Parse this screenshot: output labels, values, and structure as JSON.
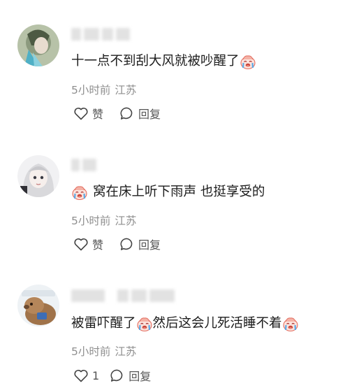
{
  "comments": [
    {
      "text_a": "十一点不到刮大风就被吵醒了",
      "text_b": "",
      "time": "5小时前",
      "location": "江苏",
      "like_label": "赞",
      "reply_label": "回复",
      "emoji": "crying-face-emoji"
    },
    {
      "text_a": "窝在床上听下雨声 也挺享受的",
      "text_b": "",
      "time": "5小时前",
      "location": "江苏",
      "like_label": "赞",
      "reply_label": "回复",
      "emoji": "crying-face-emoji"
    },
    {
      "text_a": "被雷吓醒了",
      "text_b": "然后这会儿死活睡不着",
      "time": "5小时前",
      "location": "江苏",
      "like_label": "1",
      "reply_label": "回复",
      "emoji": "crying-face-emoji"
    }
  ],
  "colors": {
    "meta": "#8f8f8f",
    "text": "#1c1c1c",
    "emoji": "#f2a7a7"
  }
}
